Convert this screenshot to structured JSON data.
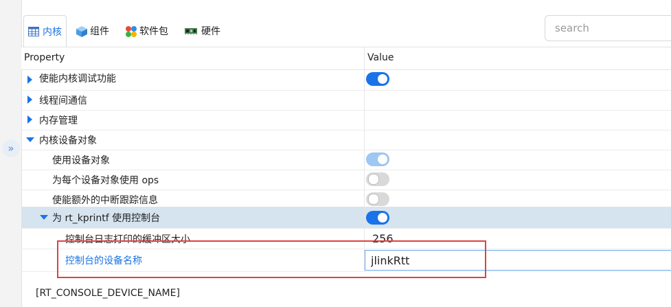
{
  "tabs": [
    {
      "label": "内核",
      "icon": "table-icon"
    },
    {
      "label": "组件",
      "icon": "cube-icon"
    },
    {
      "label": "软件包",
      "icon": "dots-icon"
    },
    {
      "label": "硬件",
      "icon": "board-icon"
    }
  ],
  "search": {
    "placeholder": "search",
    "value": ""
  },
  "grid": {
    "header_property": "Property",
    "header_value": "Value",
    "rows": [
      {
        "label": "使能内核调试功能",
        "value": "on"
      },
      {
        "label": "线程间通信"
      },
      {
        "label": "内存管理"
      },
      {
        "label": "内核设备对象"
      },
      {
        "label": "使用设备对象",
        "value": "on"
      },
      {
        "label": "为每个设备对象使用 ops",
        "value": "off"
      },
      {
        "label": "使能额外的中断跟踪信息",
        "value": "off"
      },
      {
        "label": "为 rt_kprintf 使用控制台",
        "value": "on"
      },
      {
        "label": "控制台日志打印的缓冲区大小",
        "value": "256"
      },
      {
        "label": "控制台的设备名称",
        "value": "jlinkRtt"
      }
    ]
  },
  "footer": {
    "macro": "[RT_CONSOLE_DEVICE_NAME]"
  },
  "colors": {
    "accent": "#1a73e8",
    "selected_row": "#d6e4f0",
    "highlight_box": "#e04040"
  }
}
